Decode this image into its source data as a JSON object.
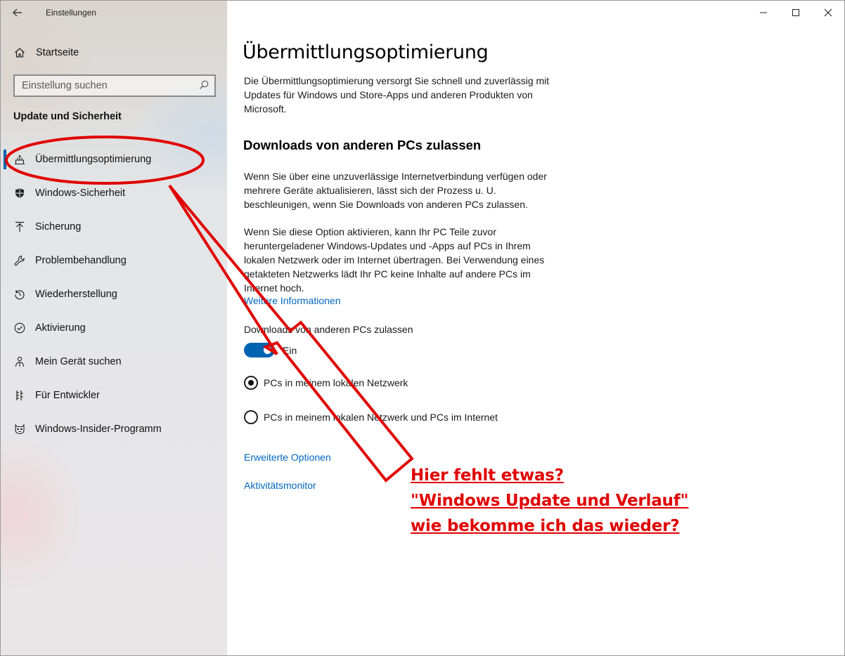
{
  "window": {
    "app_title": "Einstellungen",
    "back_icon": "arrow-left-icon",
    "controls": [
      "minimize-icon",
      "maximize-icon",
      "close-icon"
    ]
  },
  "sidebar": {
    "home_label": "Startseite",
    "search_placeholder": "Einstellung suchen",
    "section_title": "Update und Sicherheit",
    "items": [
      {
        "label": "Übermittlungsoptimierung",
        "icon": "delivery-optimization-icon",
        "active": true
      },
      {
        "label": "Windows-Sicherheit",
        "icon": "shield-icon",
        "active": false
      },
      {
        "label": "Sicherung",
        "icon": "backup-arrow-icon",
        "active": false
      },
      {
        "label": "Problembehandlung",
        "icon": "wrench-icon",
        "active": false
      },
      {
        "label": "Wiederherstellung",
        "icon": "recovery-icon",
        "active": false
      },
      {
        "label": "Aktivierung",
        "icon": "check-circle-icon",
        "active": false
      },
      {
        "label": "Mein Gerät suchen",
        "icon": "person-find-icon",
        "active": false
      },
      {
        "label": "Für Entwickler",
        "icon": "developer-tools-icon",
        "active": false
      },
      {
        "label": "Windows-Insider-Programm",
        "icon": "insider-cat-icon",
        "active": false
      }
    ]
  },
  "main": {
    "title": "Übermittlungsoptimierung",
    "intro": "Die Übermittlungsoptimierung versorgt Sie schnell und zuverlässig mit Updates für Windows und Store-Apps und anderen Produkten von Microsoft.",
    "section_heading": "Downloads von anderen PCs zulassen",
    "para1": "Wenn Sie über eine unzuverlässige Internetverbindung verfügen oder mehrere Geräte aktualisieren, lässt sich der Prozess u. U. beschleunigen, wenn Sie Downloads von anderen PCs zulassen.",
    "para2": "Wenn Sie diese Option aktivieren, kann Ihr PC Teile zuvor heruntergeladener Windows-Updates und -Apps auf PCs in Ihrem lokalen Netzwerk oder im Internet übertragen. Bei Verwendung eines getakteten Netzwerks lädt Ihr PC keine Inhalte auf andere PCs im Internet hoch.",
    "more_info_link": "Weitere Informationen",
    "toggle_label": "Downloads von anderen PCs zulassen",
    "toggle_state": "Ein",
    "toggle_on": true,
    "radio_options": [
      {
        "label": "PCs in meinem lokalen Netzwerk",
        "checked": true
      },
      {
        "label": "PCs in meinem lokalen Netzwerk und PCs im Internet",
        "checked": false
      }
    ],
    "advanced_link": "Erweiterte Optionen",
    "monitor_link": "Aktivitätsmonitor"
  },
  "annotation": {
    "lines": [
      "Hier fehlt etwas?",
      "\"Windows Update und Verlauf\"",
      "wie bekomme ich das wieder?"
    ],
    "color": "#e00000"
  },
  "colors": {
    "accent": "#0063b1",
    "link": "#0067c0",
    "annotation_red": "#e00000"
  }
}
